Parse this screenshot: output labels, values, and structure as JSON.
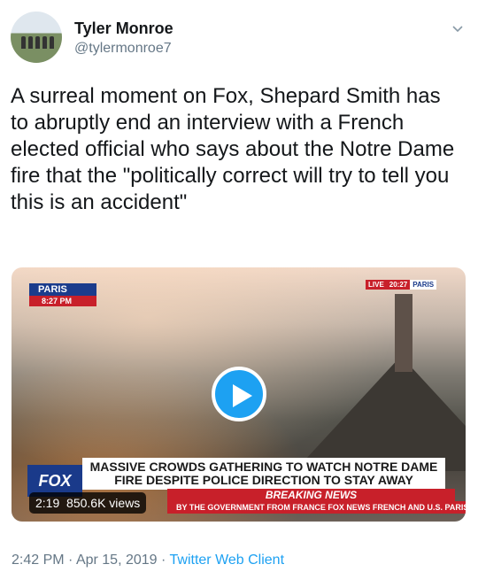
{
  "user": {
    "name": "Tyler Monroe",
    "handle": "@tylermonroe7"
  },
  "tweet": {
    "text": "A surreal moment on Fox, Shepard Smith has to abruptly end an interview with a French elected official who says about the Notre Dame fire that the \"politically correct will try to tell you this is an accident\""
  },
  "video": {
    "location_tag": "PARIS",
    "location_time": "8:27 PM",
    "live_label": "LIVE",
    "live_time": "20:27",
    "live_city": "PARIS",
    "headline_line1": "MASSIVE CROWDS GATHERING TO WATCH NOTRE DAME",
    "headline_line2": "FIRE DESPITE POLICE DIRECTION TO STAY AWAY",
    "network": "FOX",
    "banner": "BREAKING NEWS",
    "ticker": "BY THE GOVERNMENT FROM FRANCE   FOX NEWS FRENCH AND U.S.  PARIS",
    "duration": "2:19",
    "views": "850.6K views"
  },
  "meta": {
    "time": "2:42 PM",
    "date": "Apr 15, 2019",
    "separator": "·",
    "client": "Twitter Web Client"
  }
}
